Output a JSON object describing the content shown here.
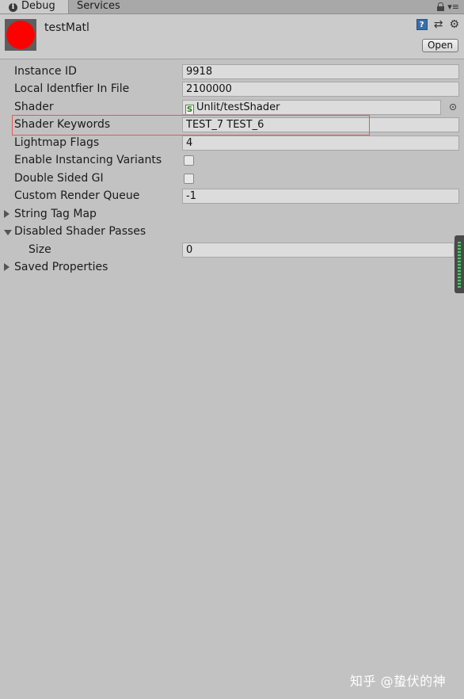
{
  "tabs": [
    {
      "label": "Debug",
      "active": true
    },
    {
      "label": "Services",
      "active": false
    }
  ],
  "header": {
    "title": "testMatl",
    "preview_color": "#ff0000",
    "open_button": "Open",
    "icons": [
      "help-icon",
      "preset-icon",
      "gear-icon"
    ]
  },
  "properties": {
    "instance_id": {
      "label": "Instance ID",
      "value": "9918"
    },
    "local_identifier": {
      "label": "Local Identfier In File",
      "value": "2100000"
    },
    "shader": {
      "label": "Shader",
      "value": "Unlit/testShader"
    },
    "shader_keywords": {
      "label": "Shader Keywords",
      "value": "TEST_7 TEST_6"
    },
    "lightmap_flags": {
      "label": "Lightmap Flags",
      "value": "4"
    },
    "enable_instancing": {
      "label": "Enable Instancing Variants",
      "checked": false
    },
    "double_sided_gi": {
      "label": "Double Sided GI",
      "checked": false
    },
    "render_queue": {
      "label": "Custom Render Queue",
      "value": "-1"
    },
    "string_tag_map": {
      "label": "String Tag Map",
      "expanded": false
    },
    "disabled_shader_passes": {
      "label": "Disabled Shader Passes",
      "expanded": true
    },
    "size": {
      "label": "Size",
      "value": "0"
    },
    "saved_properties": {
      "label": "Saved Properties",
      "expanded": false
    }
  },
  "highlight_color": "#e05a5a",
  "watermark": "知乎 @蛰伏的神"
}
